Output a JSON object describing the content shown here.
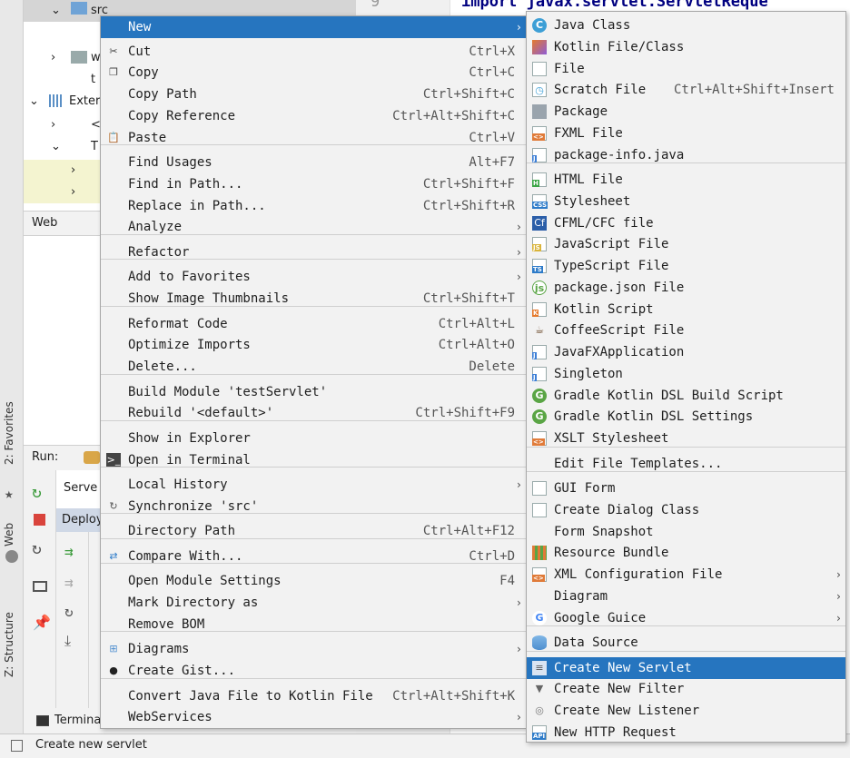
{
  "left_strip": {
    "favorites": "2: Favorites",
    "web": "Web",
    "structure": "Z: Structure"
  },
  "project_tree": {
    "src": "src",
    "w_item": "w",
    "t_item": "t",
    "external": "Exter",
    "lt_item": "<",
    "t2_item": "T"
  },
  "web_panel": {
    "title": "Web"
  },
  "run_panel": {
    "label": "Run:",
    "server_tab": "Serve",
    "deploy": "Deploy",
    "terminal": "Termina"
  },
  "editor": {
    "line_number": "9",
    "code": "import javax.servlet.ServletReque"
  },
  "status_bar": {
    "text": "Create new servlet"
  },
  "context_menu": {
    "items": [
      {
        "label": "New",
        "shortcut": "",
        "submenu": true,
        "icon": ""
      },
      {
        "label": "Cut",
        "shortcut": "Ctrl+X",
        "icon": "scissors-icon"
      },
      {
        "label": "Copy",
        "shortcut": "Ctrl+C",
        "icon": "copy-icon"
      },
      {
        "label": "Copy Path",
        "shortcut": "Ctrl+Shift+C",
        "icon": ""
      },
      {
        "label": "Copy Reference",
        "shortcut": "Ctrl+Alt+Shift+C",
        "icon": ""
      },
      {
        "label": "Paste",
        "shortcut": "Ctrl+V",
        "icon": "paste-icon"
      },
      {
        "label": "Find Usages",
        "shortcut": "Alt+F7",
        "icon": ""
      },
      {
        "label": "Find in Path...",
        "shortcut": "Ctrl+Shift+F",
        "icon": ""
      },
      {
        "label": "Replace in Path...",
        "shortcut": "Ctrl+Shift+R",
        "icon": ""
      },
      {
        "label": "Analyze",
        "shortcut": "",
        "submenu": true,
        "icon": ""
      },
      {
        "label": "Refactor",
        "shortcut": "",
        "submenu": true,
        "icon": ""
      },
      {
        "label": "Add to Favorites",
        "shortcut": "",
        "submenu": true,
        "icon": ""
      },
      {
        "label": "Show Image Thumbnails",
        "shortcut": "Ctrl+Shift+T",
        "icon": ""
      },
      {
        "label": "Reformat Code",
        "shortcut": "Ctrl+Alt+L",
        "icon": ""
      },
      {
        "label": "Optimize Imports",
        "shortcut": "Ctrl+Alt+O",
        "icon": ""
      },
      {
        "label": "Delete...",
        "shortcut": "Delete",
        "icon": ""
      },
      {
        "label": "Build Module 'testServlet'",
        "shortcut": "",
        "icon": ""
      },
      {
        "label": "Rebuild '<default>'",
        "shortcut": "Ctrl+Shift+F9",
        "icon": ""
      },
      {
        "label": "Show in Explorer",
        "shortcut": "",
        "icon": ""
      },
      {
        "label": "Open in Terminal",
        "shortcut": "",
        "icon": "terminal-icon"
      },
      {
        "label": "Local History",
        "shortcut": "",
        "submenu": true,
        "icon": ""
      },
      {
        "label": "Synchronize 'src'",
        "shortcut": "",
        "icon": "sync-icon"
      },
      {
        "label": "Directory Path",
        "shortcut": "Ctrl+Alt+F12",
        "icon": ""
      },
      {
        "label": "Compare With...",
        "shortcut": "Ctrl+D",
        "icon": "compare-icon"
      },
      {
        "label": "Open Module Settings",
        "shortcut": "F4",
        "icon": ""
      },
      {
        "label": "Mark Directory as",
        "shortcut": "",
        "submenu": true,
        "icon": ""
      },
      {
        "label": "Remove BOM",
        "shortcut": "",
        "icon": ""
      },
      {
        "label": "Diagrams",
        "shortcut": "",
        "submenu": true,
        "icon": "diagram-icon"
      },
      {
        "label": "Create Gist...",
        "shortcut": "",
        "icon": "github-icon"
      },
      {
        "label": "Convert Java File to Kotlin File",
        "shortcut": "Ctrl+Alt+Shift+K",
        "icon": ""
      },
      {
        "label": "WebServices",
        "shortcut": "",
        "submenu": true,
        "icon": ""
      }
    ]
  },
  "new_submenu": {
    "items": [
      {
        "label": "Java Class",
        "shortcut": "",
        "icon": "java-class-icon"
      },
      {
        "label": "Kotlin File/Class",
        "shortcut": "",
        "icon": "kotlin-file-icon"
      },
      {
        "label": "File",
        "shortcut": "",
        "icon": "file-icon"
      },
      {
        "label": "Scratch File",
        "shortcut": "Ctrl+Alt+Shift+Insert",
        "icon": "scratch-file-icon"
      },
      {
        "label": "Package",
        "shortcut": "",
        "icon": "package-icon"
      },
      {
        "label": "FXML File",
        "shortcut": "",
        "icon": "fxml-file-icon"
      },
      {
        "label": "package-info.java",
        "shortcut": "",
        "icon": "java-file-icon"
      },
      {
        "label": "HTML File",
        "shortcut": "",
        "icon": "html-file-icon"
      },
      {
        "label": "Stylesheet",
        "shortcut": "",
        "icon": "css-file-icon"
      },
      {
        "label": "CFML/CFC file",
        "shortcut": "",
        "icon": "cfml-file-icon"
      },
      {
        "label": "JavaScript File",
        "shortcut": "",
        "icon": "javascript-file-icon"
      },
      {
        "label": "TypeScript File",
        "shortcut": "",
        "icon": "typescript-file-icon"
      },
      {
        "label": "package.json File",
        "shortcut": "",
        "icon": "nodejs-icon"
      },
      {
        "label": "Kotlin Script",
        "shortcut": "",
        "icon": "kotlin-script-icon"
      },
      {
        "label": "CoffeeScript File",
        "shortcut": "",
        "icon": "coffeescript-icon"
      },
      {
        "label": "JavaFXApplication",
        "shortcut": "",
        "icon": "java-file-icon"
      },
      {
        "label": "Singleton",
        "shortcut": "",
        "icon": "java-file-icon"
      },
      {
        "label": "Gradle Kotlin DSL Build Script",
        "shortcut": "",
        "icon": "gradle-icon"
      },
      {
        "label": "Gradle Kotlin DSL Settings",
        "shortcut": "",
        "icon": "gradle-icon"
      },
      {
        "label": "XSLT Stylesheet",
        "shortcut": "",
        "icon": "xslt-file-icon"
      },
      {
        "label": "Edit File Templates...",
        "shortcut": "",
        "icon": ""
      },
      {
        "label": "GUI Form",
        "shortcut": "",
        "icon": "gui-form-icon"
      },
      {
        "label": "Create Dialog Class",
        "shortcut": "",
        "icon": "dialog-icon"
      },
      {
        "label": "Form Snapshot",
        "shortcut": "",
        "icon": ""
      },
      {
        "label": "Resource Bundle",
        "shortcut": "",
        "icon": "resource-bundle-icon"
      },
      {
        "label": "XML Configuration File",
        "shortcut": "",
        "submenu": true,
        "icon": "xml-file-icon"
      },
      {
        "label": "Diagram",
        "shortcut": "",
        "submenu": true,
        "icon": ""
      },
      {
        "label": "Google Guice",
        "shortcut": "",
        "submenu": true,
        "icon": "google-icon"
      },
      {
        "label": "Data Source",
        "shortcut": "",
        "icon": "database-icon"
      },
      {
        "label": "Create New Servlet",
        "shortcut": "",
        "selected": true,
        "icon": "servlet-icon"
      },
      {
        "label": "Create New Filter",
        "shortcut": "",
        "icon": "filter-icon"
      },
      {
        "label": "Create New Listener",
        "shortcut": "",
        "icon": "listener-icon"
      },
      {
        "label": "New HTTP Request",
        "shortcut": "",
        "icon": "api-icon"
      }
    ]
  }
}
